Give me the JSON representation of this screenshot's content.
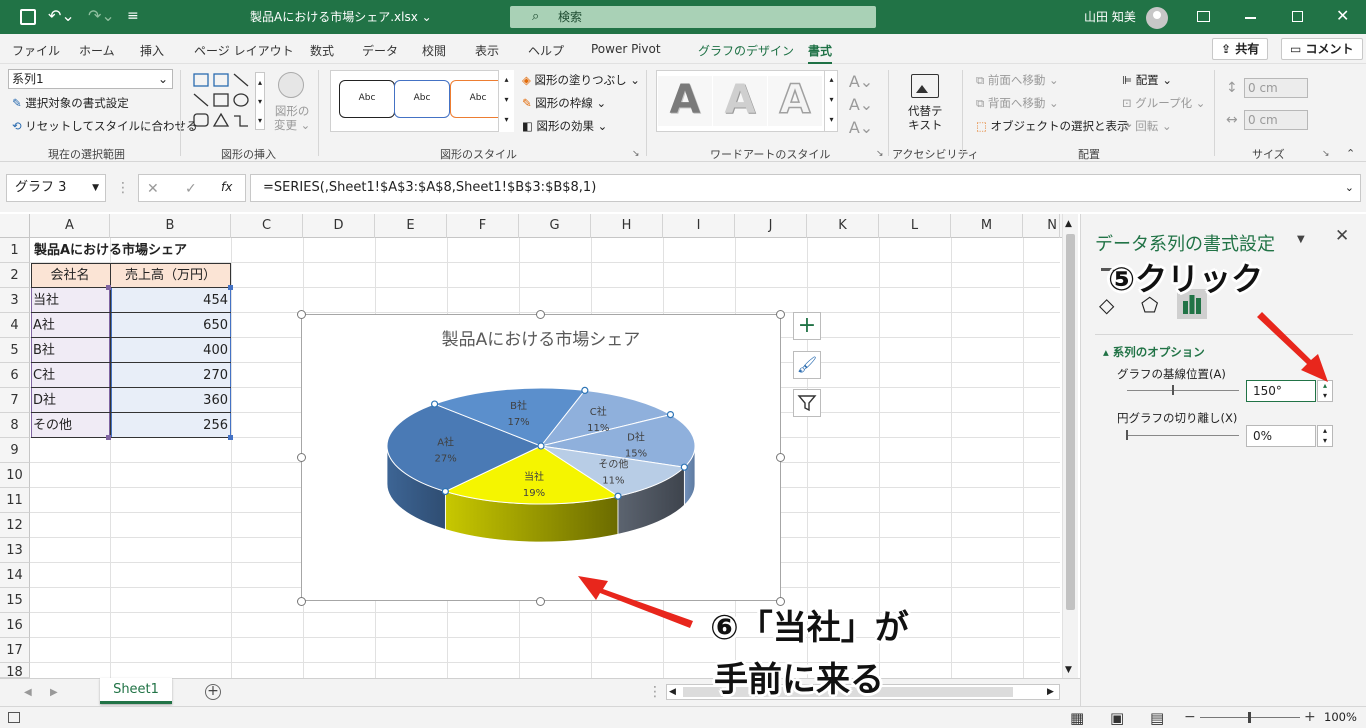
{
  "titlebar": {
    "filename": "製品Aにおける市場シェア.xlsx",
    "dropdown": "⌄",
    "search_placeholder": "検索",
    "user": "山田 知美"
  },
  "tabs": [
    "ファイル",
    "ホーム",
    "挿入",
    "ページ レイアウト",
    "数式",
    "データ",
    "校閲",
    "表示",
    "ヘルプ",
    "Power Pivot",
    "グラフのデザイン",
    "書式"
  ],
  "tab_buttons": {
    "share": "共有",
    "comment": "コメント"
  },
  "ribbon": {
    "selection": {
      "combo_value": "系列1",
      "format_selection": "選択対象の書式設定",
      "reset_style": "リセットしてスタイルに合わせる",
      "label": "現在の選択範囲"
    },
    "insert_shapes": {
      "change_shape_1": "図形の",
      "change_shape_2": "変更",
      "label": "図形の挿入"
    },
    "shape_styles": {
      "sample": "Abc",
      "fill": "図形の塗りつぶし",
      "outline": "図形の枠線",
      "effects": "図形の効果",
      "label": "図形のスタイル"
    },
    "wordart": {
      "letter": "A",
      "label": "ワードアートのスタイル"
    },
    "accessibility": {
      "alt_text_1": "代替テ",
      "alt_text_2": "キスト",
      "label": "アクセシビリティ"
    },
    "arrange": {
      "bring_forward": "前面へ移動",
      "send_backward": "背面へ移動",
      "selection_pane": "オブジェクトの選択と表示",
      "align": "配置",
      "group": "グループ化",
      "rotate": "回転",
      "label": "配置"
    },
    "size": {
      "height": "0 cm",
      "width": "0 cm",
      "label": "サイズ"
    }
  },
  "formula_bar": {
    "name_box": "グラフ 3",
    "fx": "fx",
    "formula": "=SERIES(,Sheet1!$A$3:$A$8,Sheet1!$B$3:$B$8,1)"
  },
  "columns": [
    "A",
    "B",
    "C",
    "D",
    "E",
    "F",
    "G",
    "H",
    "I",
    "J",
    "K",
    "L",
    "M",
    "N"
  ],
  "rows": [
    "1",
    "2",
    "3",
    "4",
    "5",
    "6",
    "7",
    "8",
    "9",
    "10",
    "11",
    "12",
    "13",
    "14",
    "15",
    "16",
    "17",
    "18"
  ],
  "sheet": {
    "title": "製品Aにおける市場シェア",
    "headers": [
      "会社名",
      "売上高（万円）"
    ],
    "data": [
      {
        "name": "当社",
        "value": "454"
      },
      {
        "name": "A社",
        "value": "650"
      },
      {
        "name": "B社",
        "value": "400"
      },
      {
        "name": "C社",
        "value": "270"
      },
      {
        "name": "D社",
        "value": "360"
      },
      {
        "name": "その他",
        "value": "256"
      }
    ]
  },
  "chart_data": {
    "type": "pie",
    "title": "製品Aにおける市場シェア",
    "categories": [
      "当社",
      "A社",
      "B社",
      "C社",
      "D社",
      "その他"
    ],
    "values": [
      454,
      650,
      400,
      270,
      360,
      256
    ],
    "labels": [
      {
        "name": "当社",
        "pct": "19%"
      },
      {
        "name": "A社",
        "pct": "27%"
      },
      {
        "name": "B社",
        "pct": "17%"
      },
      {
        "name": "C社",
        "pct": "11%"
      },
      {
        "name": "D社",
        "pct": "15%"
      },
      {
        "name": "その他",
        "pct": "11%"
      }
    ],
    "first_slice_angle": 150,
    "colors": {
      "highlight": "#f5f500",
      "blue_dark": "#4a7ab5",
      "blue_mid": "#5b8fcc",
      "blue_light": "#8fb0dc",
      "blue_pale": "#b8cde6"
    }
  },
  "pane": {
    "title": "データ系列の書式設定",
    "section": "系列のオプション",
    "first_slice_label": "グラフの基線位置(A)",
    "first_slice_value": "150°",
    "explosion_label": "円グラフの切り離し(X)",
    "explosion_value": "0%"
  },
  "annotations": {
    "step5": "⑤クリック",
    "step6_line1": "⑥「当社」が",
    "step6_line2": "手前に来る"
  },
  "sheet_tab": "Sheet1",
  "status": {
    "zoom": "100%"
  },
  "colors": {
    "excel_green": "#217346",
    "arrow_red": "#e8261c"
  }
}
